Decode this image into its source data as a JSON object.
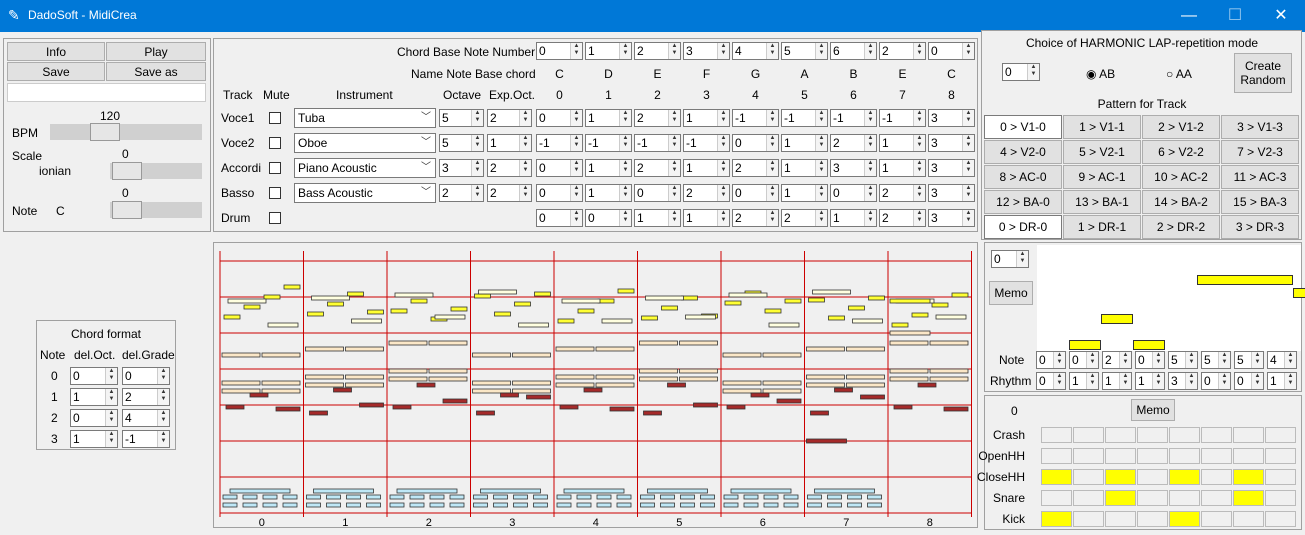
{
  "window": {
    "title": "DadoSoft - MidiCrea",
    "minimize": "—",
    "maximize": "☐",
    "close": "✕"
  },
  "left": {
    "info": "Info",
    "play": "Play",
    "save": "Save",
    "save_as": "Save as",
    "bpm_label": "BPM",
    "bpm_value": "120",
    "scale_label": "Scale",
    "scale_value": "0",
    "scale_name": "ionian",
    "note_label": "Note",
    "note_name": "C",
    "note_value": "0"
  },
  "chord_format": {
    "title": "Chord format",
    "headers": [
      "Note",
      "del.Oct.",
      "del.Grade"
    ],
    "rows": [
      [
        "0",
        "0",
        "0"
      ],
      [
        "1",
        "1",
        "2"
      ],
      [
        "2",
        "0",
        "4"
      ],
      [
        "3",
        "1",
        "-1"
      ]
    ]
  },
  "tracks": {
    "chord_base_label": "Chord Base Note Number",
    "chord_base_values": [
      "0",
      "1",
      "2",
      "3",
      "4",
      "5",
      "6",
      "2",
      "0"
    ],
    "name_note_label": "Name Note Base chord",
    "note_names": [
      "C",
      "D",
      "E",
      "F",
      "G",
      "A",
      "B",
      "E",
      "C"
    ],
    "col_index": [
      "0",
      "1",
      "2",
      "3",
      "4",
      "5",
      "6",
      "7",
      "8"
    ],
    "headers": {
      "track": "Track",
      "mute": "Mute",
      "instrument": "Instrument",
      "octave": "Octave",
      "exp_oct": "Exp.Oct."
    },
    "rows": [
      {
        "name": "Voce1",
        "instrument": "Tuba",
        "octave": "5",
        "exp": "2",
        "values": [
          "0",
          "1",
          "2",
          "1",
          "-1",
          "-1",
          "-1",
          "-1",
          "3"
        ]
      },
      {
        "name": "Voce2",
        "instrument": "Oboe",
        "octave": "5",
        "exp": "1",
        "values": [
          "-1",
          "-1",
          "-1",
          "-1",
          "0",
          "1",
          "2",
          "1",
          "3"
        ]
      },
      {
        "name": "Accordi",
        "instrument": "Piano Acoustic",
        "octave": "3",
        "exp": "2",
        "values": [
          "0",
          "1",
          "2",
          "1",
          "2",
          "1",
          "3",
          "1",
          "3"
        ]
      },
      {
        "name": "Basso",
        "instrument": "Bass Acoustic",
        "octave": "2",
        "exp": "2",
        "values": [
          "0",
          "1",
          "0",
          "2",
          "0",
          "1",
          "0",
          "2",
          "3"
        ]
      },
      {
        "name": "Drum",
        "instrument": "",
        "octave": "",
        "exp": "",
        "values": [
          "0",
          "0",
          "1",
          "1",
          "2",
          "2",
          "1",
          "2",
          "3"
        ]
      }
    ]
  },
  "harmonic": {
    "title": "Choice of HARMONIC LAP-repetition mode",
    "spin": "0",
    "opt_ab": "AB",
    "opt_aa": "AA",
    "create_random": [
      "Create",
      "Random"
    ],
    "pattern_title": "Pattern for Track",
    "patterns": [
      "0 > V1-0",
      "1 > V1-1",
      "2 > V1-2",
      "3 > V1-3",
      "4 > V2-0",
      "5 > V2-1",
      "6 > V2-2",
      "7 > V2-3",
      "8 > AC-0",
      "9 > AC-1",
      "10 > AC-2",
      "11 > AC-3",
      "12 > BA-0",
      "13 > BA-1",
      "14 > BA-2",
      "15 > BA-3",
      "0 > DR-0",
      "1 > DR-1",
      "2 > DR-2",
      "3 > DR-3"
    ]
  },
  "pattern_editor": {
    "spin": "0",
    "memo": "Memo",
    "note_label": "Note",
    "rhythm_label": "Rhythm",
    "notes": [
      "0",
      "0",
      "2",
      "0",
      "5",
      "5",
      "5",
      "4"
    ],
    "rhythm": [
      "0",
      "1",
      "1",
      "1",
      "3",
      "0",
      "0",
      "1"
    ],
    "bars": [
      {
        "pos": 0,
        "len": 1,
        "level": 0
      },
      {
        "pos": 1,
        "len": 1,
        "level": 2
      },
      {
        "pos": 2,
        "len": 1,
        "level": 0
      },
      {
        "pos": 4,
        "len": 3,
        "level": 5
      },
      {
        "pos": 7,
        "len": 1,
        "level": 4
      }
    ]
  },
  "drum": {
    "counter": "0",
    "memo": "Memo",
    "rows": [
      {
        "name": "Crash",
        "cells": [
          0,
          0,
          0,
          0,
          0,
          0,
          0,
          0
        ]
      },
      {
        "name": "OpenHH",
        "cells": [
          0,
          0,
          0,
          0,
          0,
          0,
          0,
          0
        ]
      },
      {
        "name": "CloseHH",
        "cells": [
          1,
          0,
          1,
          0,
          1,
          0,
          1,
          0
        ]
      },
      {
        "name": "Snare",
        "cells": [
          0,
          0,
          1,
          0,
          0,
          0,
          1,
          0
        ]
      },
      {
        "name": "Kick",
        "cells": [
          1,
          0,
          0,
          0,
          1,
          0,
          0,
          0
        ]
      }
    ]
  },
  "roll": {
    "measures": [
      "0",
      "1",
      "2",
      "3",
      "4",
      "5",
      "6",
      "7",
      "8"
    ],
    "colors": {
      "voce1": "#ffff33",
      "voce2": "#ffffe0",
      "accordi": "#fbe7c7",
      "basso": "#a52a2a",
      "drum": "#bfe8f7",
      "grid": "#cc0000"
    }
  }
}
